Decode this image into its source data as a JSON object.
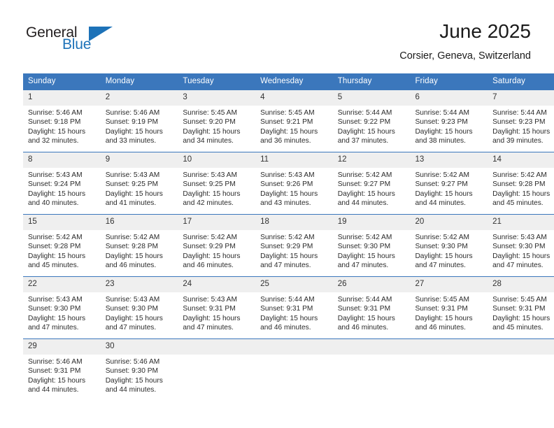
{
  "brand": {
    "name_top": "General",
    "name_bottom": "Blue",
    "color_primary": "#1d72b8",
    "color_text": "#231f20"
  },
  "header": {
    "title": "June 2025",
    "subtitle": "Corsier, Geneva, Switzerland"
  },
  "theme": {
    "header_bg": "#3b77bc",
    "daynum_bg": "#efefef",
    "border": "#3b77bc"
  },
  "weekdays": [
    "Sunday",
    "Monday",
    "Tuesday",
    "Wednesday",
    "Thursday",
    "Friday",
    "Saturday"
  ],
  "weeks": [
    [
      {
        "day": "1",
        "sunrise": "Sunrise: 5:46 AM",
        "sunset": "Sunset: 9:18 PM",
        "daylight": "Daylight: 15 hours and 32 minutes."
      },
      {
        "day": "2",
        "sunrise": "Sunrise: 5:46 AM",
        "sunset": "Sunset: 9:19 PM",
        "daylight": "Daylight: 15 hours and 33 minutes."
      },
      {
        "day": "3",
        "sunrise": "Sunrise: 5:45 AM",
        "sunset": "Sunset: 9:20 PM",
        "daylight": "Daylight: 15 hours and 34 minutes."
      },
      {
        "day": "4",
        "sunrise": "Sunrise: 5:45 AM",
        "sunset": "Sunset: 9:21 PM",
        "daylight": "Daylight: 15 hours and 36 minutes."
      },
      {
        "day": "5",
        "sunrise": "Sunrise: 5:44 AM",
        "sunset": "Sunset: 9:22 PM",
        "daylight": "Daylight: 15 hours and 37 minutes."
      },
      {
        "day": "6",
        "sunrise": "Sunrise: 5:44 AM",
        "sunset": "Sunset: 9:23 PM",
        "daylight": "Daylight: 15 hours and 38 minutes."
      },
      {
        "day": "7",
        "sunrise": "Sunrise: 5:44 AM",
        "sunset": "Sunset: 9:23 PM",
        "daylight": "Daylight: 15 hours and 39 minutes."
      }
    ],
    [
      {
        "day": "8",
        "sunrise": "Sunrise: 5:43 AM",
        "sunset": "Sunset: 9:24 PM",
        "daylight": "Daylight: 15 hours and 40 minutes."
      },
      {
        "day": "9",
        "sunrise": "Sunrise: 5:43 AM",
        "sunset": "Sunset: 9:25 PM",
        "daylight": "Daylight: 15 hours and 41 minutes."
      },
      {
        "day": "10",
        "sunrise": "Sunrise: 5:43 AM",
        "sunset": "Sunset: 9:25 PM",
        "daylight": "Daylight: 15 hours and 42 minutes."
      },
      {
        "day": "11",
        "sunrise": "Sunrise: 5:43 AM",
        "sunset": "Sunset: 9:26 PM",
        "daylight": "Daylight: 15 hours and 43 minutes."
      },
      {
        "day": "12",
        "sunrise": "Sunrise: 5:42 AM",
        "sunset": "Sunset: 9:27 PM",
        "daylight": "Daylight: 15 hours and 44 minutes."
      },
      {
        "day": "13",
        "sunrise": "Sunrise: 5:42 AM",
        "sunset": "Sunset: 9:27 PM",
        "daylight": "Daylight: 15 hours and 44 minutes."
      },
      {
        "day": "14",
        "sunrise": "Sunrise: 5:42 AM",
        "sunset": "Sunset: 9:28 PM",
        "daylight": "Daylight: 15 hours and 45 minutes."
      }
    ],
    [
      {
        "day": "15",
        "sunrise": "Sunrise: 5:42 AM",
        "sunset": "Sunset: 9:28 PM",
        "daylight": "Daylight: 15 hours and 45 minutes."
      },
      {
        "day": "16",
        "sunrise": "Sunrise: 5:42 AM",
        "sunset": "Sunset: 9:28 PM",
        "daylight": "Daylight: 15 hours and 46 minutes."
      },
      {
        "day": "17",
        "sunrise": "Sunrise: 5:42 AM",
        "sunset": "Sunset: 9:29 PM",
        "daylight": "Daylight: 15 hours and 46 minutes."
      },
      {
        "day": "18",
        "sunrise": "Sunrise: 5:42 AM",
        "sunset": "Sunset: 9:29 PM",
        "daylight": "Daylight: 15 hours and 47 minutes."
      },
      {
        "day": "19",
        "sunrise": "Sunrise: 5:42 AM",
        "sunset": "Sunset: 9:30 PM",
        "daylight": "Daylight: 15 hours and 47 minutes."
      },
      {
        "day": "20",
        "sunrise": "Sunrise: 5:42 AM",
        "sunset": "Sunset: 9:30 PM",
        "daylight": "Daylight: 15 hours and 47 minutes."
      },
      {
        "day": "21",
        "sunrise": "Sunrise: 5:43 AM",
        "sunset": "Sunset: 9:30 PM",
        "daylight": "Daylight: 15 hours and 47 minutes."
      }
    ],
    [
      {
        "day": "22",
        "sunrise": "Sunrise: 5:43 AM",
        "sunset": "Sunset: 9:30 PM",
        "daylight": "Daylight: 15 hours and 47 minutes."
      },
      {
        "day": "23",
        "sunrise": "Sunrise: 5:43 AM",
        "sunset": "Sunset: 9:30 PM",
        "daylight": "Daylight: 15 hours and 47 minutes."
      },
      {
        "day": "24",
        "sunrise": "Sunrise: 5:43 AM",
        "sunset": "Sunset: 9:31 PM",
        "daylight": "Daylight: 15 hours and 47 minutes."
      },
      {
        "day": "25",
        "sunrise": "Sunrise: 5:44 AM",
        "sunset": "Sunset: 9:31 PM",
        "daylight": "Daylight: 15 hours and 46 minutes."
      },
      {
        "day": "26",
        "sunrise": "Sunrise: 5:44 AM",
        "sunset": "Sunset: 9:31 PM",
        "daylight": "Daylight: 15 hours and 46 minutes."
      },
      {
        "day": "27",
        "sunrise": "Sunrise: 5:45 AM",
        "sunset": "Sunset: 9:31 PM",
        "daylight": "Daylight: 15 hours and 46 minutes."
      },
      {
        "day": "28",
        "sunrise": "Sunrise: 5:45 AM",
        "sunset": "Sunset: 9:31 PM",
        "daylight": "Daylight: 15 hours and 45 minutes."
      }
    ],
    [
      {
        "day": "29",
        "sunrise": "Sunrise: 5:46 AM",
        "sunset": "Sunset: 9:31 PM",
        "daylight": "Daylight: 15 hours and 44 minutes."
      },
      {
        "day": "30",
        "sunrise": "Sunrise: 5:46 AM",
        "sunset": "Sunset: 9:30 PM",
        "daylight": "Daylight: 15 hours and 44 minutes."
      },
      {
        "day": "",
        "sunrise": "",
        "sunset": "",
        "daylight": ""
      },
      {
        "day": "",
        "sunrise": "",
        "sunset": "",
        "daylight": ""
      },
      {
        "day": "",
        "sunrise": "",
        "sunset": "",
        "daylight": ""
      },
      {
        "day": "",
        "sunrise": "",
        "sunset": "",
        "daylight": ""
      },
      {
        "day": "",
        "sunrise": "",
        "sunset": "",
        "daylight": ""
      }
    ]
  ]
}
